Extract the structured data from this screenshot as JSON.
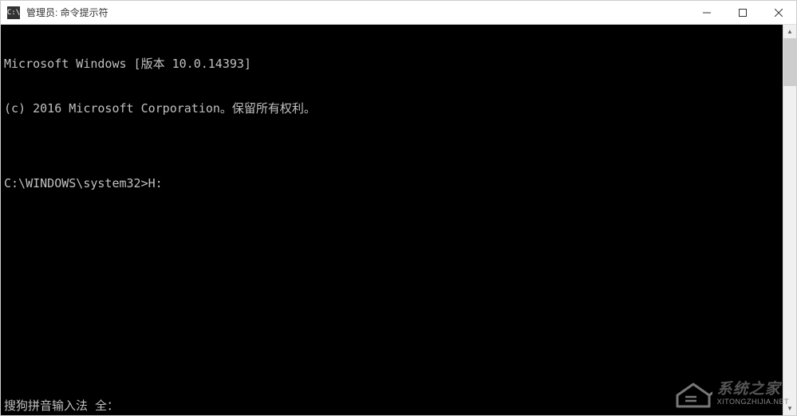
{
  "window": {
    "title": "管理员: 命令提示符",
    "icon": "C:\\"
  },
  "terminal": {
    "line1": "Microsoft Windows [版本 10.0.14393]",
    "line2": "(c) 2016 Microsoft Corporation。保留所有权利。",
    "blank": "",
    "prompt": "C:\\WINDOWS\\system32>",
    "command": "H:",
    "status": "搜狗拼音输入法 全："
  },
  "watermark": {
    "title": "系统之家",
    "sub": "XITONGZHIJIA.NET"
  }
}
